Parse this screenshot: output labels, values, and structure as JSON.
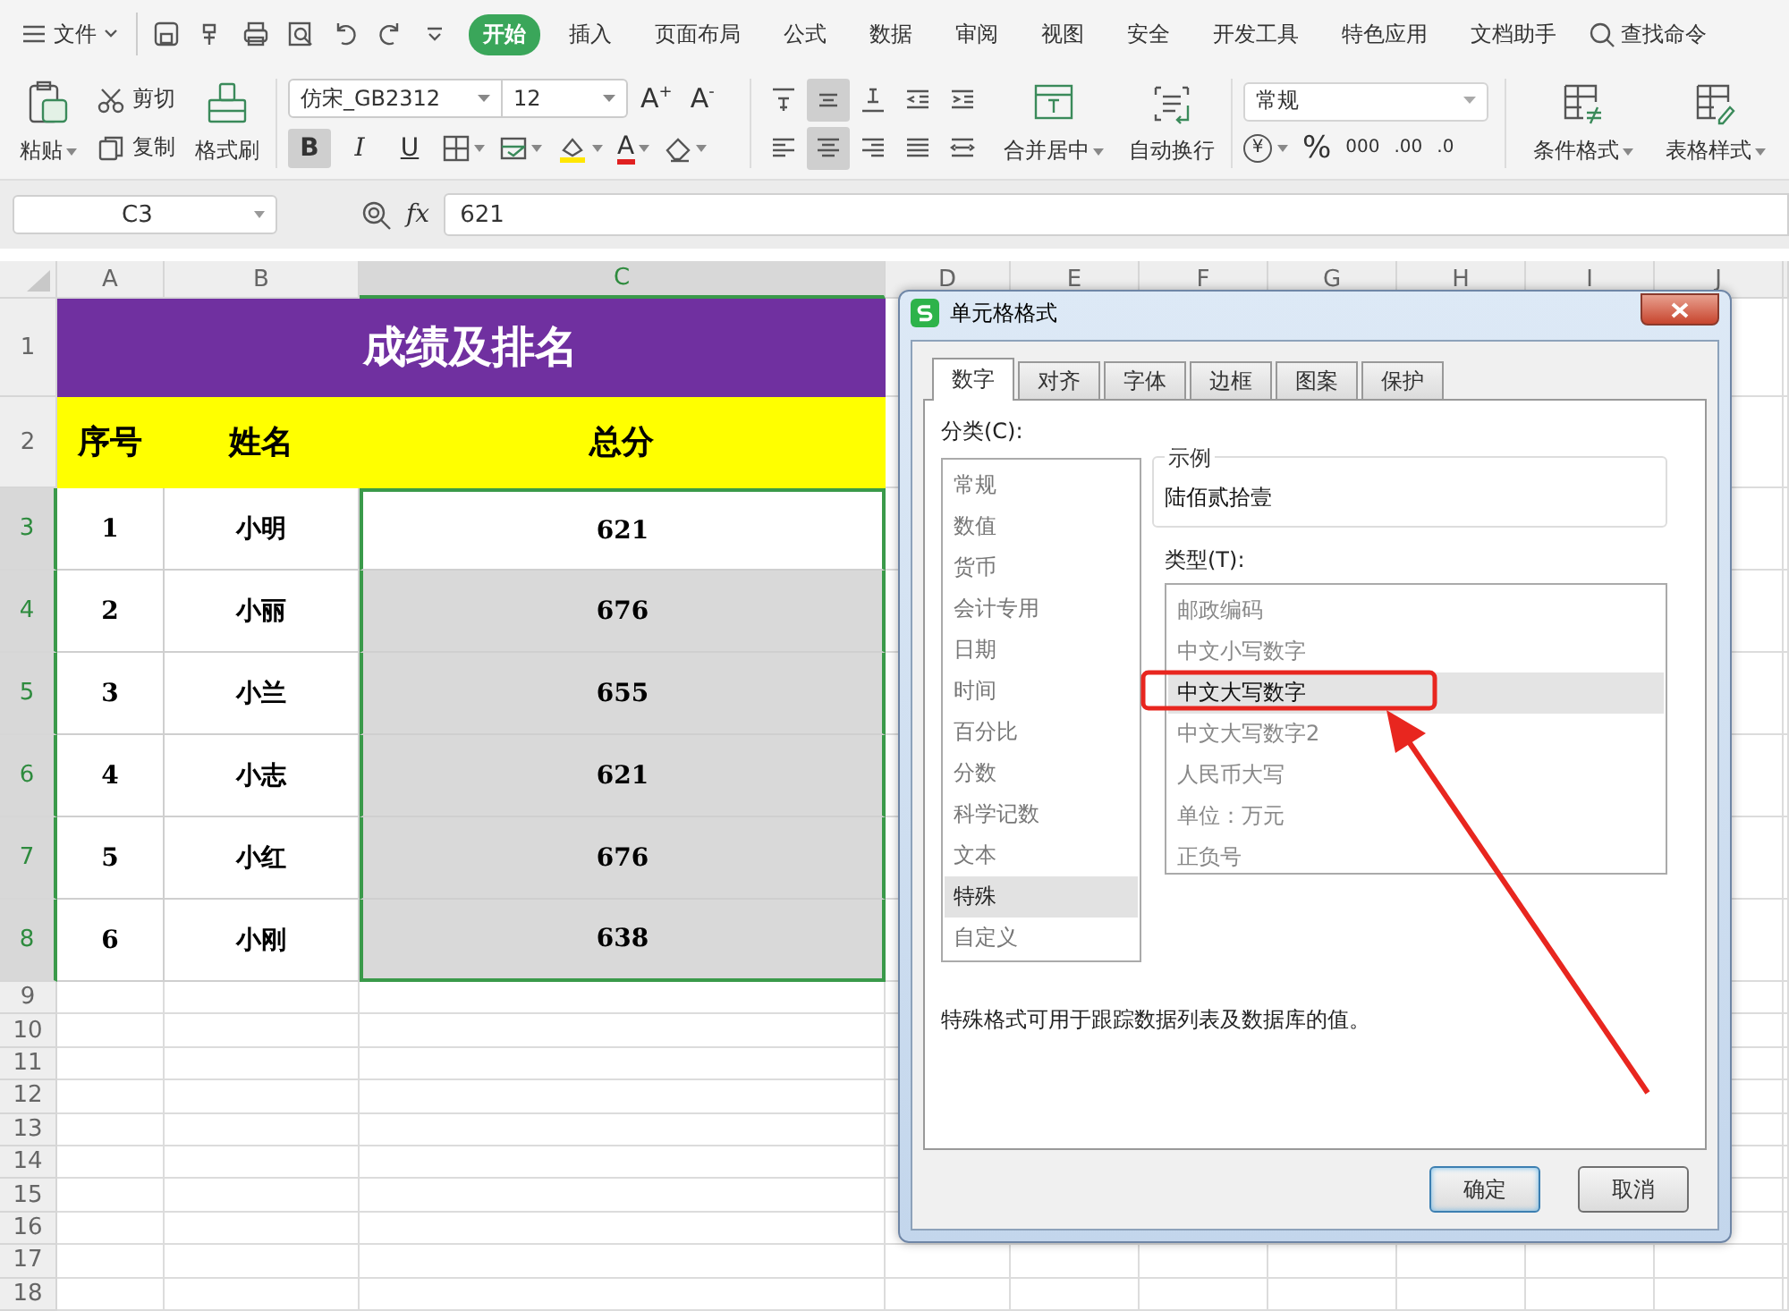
{
  "menu": {
    "file_label": "文件",
    "tabs": [
      {
        "label": "开始",
        "selected": true
      },
      {
        "label": "插入",
        "selected": false
      },
      {
        "label": "页面布局",
        "selected": false
      },
      {
        "label": "公式",
        "selected": false
      },
      {
        "label": "数据",
        "selected": false
      },
      {
        "label": "审阅",
        "selected": false
      },
      {
        "label": "视图",
        "selected": false
      },
      {
        "label": "安全",
        "selected": false
      },
      {
        "label": "开发工具",
        "selected": false
      },
      {
        "label": "特色应用",
        "selected": false
      },
      {
        "label": "文档助手",
        "selected": false
      }
    ],
    "search_label": "查找命令"
  },
  "ribbon": {
    "paste": "粘贴",
    "cut": "剪切",
    "copy": "复制",
    "format_painter": "格式刷",
    "font_name": "仿宋_GB2312",
    "font_size": "12",
    "size_buttons": [
      "A$^{+}$",
      "A$^{-}$"
    ],
    "font_styles": [
      {
        "kind": "bold",
        "label": "B",
        "on": true
      },
      {
        "kind": "italic",
        "label": "I",
        "on": false
      },
      {
        "kind": "underline",
        "label": "U",
        "on": false
      }
    ],
    "font_color_label": "A",
    "alignment": [
      {
        "kind": "top",
        "on": false
      },
      {
        "kind": "middle",
        "on": true
      },
      {
        "kind": "bottom",
        "on": false
      },
      {
        "kind": "left",
        "on": false
      },
      {
        "kind": "center",
        "on": true
      },
      {
        "kind": "right",
        "on": false
      }
    ],
    "merge_center": "合并居中",
    "wrap_text": "自动换行",
    "number_format": "常规",
    "number_buttons": [
      {
        "kind": "currency",
        "label": "¥"
      },
      {
        "kind": "percent",
        "label": "%"
      },
      {
        "kind": "thousands",
        "label": "000"
      },
      {
        "kind": "add_decimal",
        "label": ".00"
      },
      {
        "kind": "remove_decimal",
        "label": ".0"
      }
    ],
    "conditional_format": "条件格式",
    "table_style": "表格样式"
  },
  "formula_bar": {
    "cell_ref": "C3",
    "fx": "fx",
    "value": "621"
  },
  "sheet": {
    "columns": [
      {
        "label": "A",
        "selected": false
      },
      {
        "label": "B",
        "selected": false
      },
      {
        "label": "C",
        "selected": true
      },
      {
        "label": "D",
        "selected": false
      },
      {
        "label": "E",
        "selected": false
      },
      {
        "label": "F",
        "selected": false
      },
      {
        "label": "G",
        "selected": false
      },
      {
        "label": "H",
        "selected": false
      },
      {
        "label": "I",
        "selected": false
      },
      {
        "label": "J",
        "selected": false
      }
    ],
    "row_headers": [
      {
        "label": "1",
        "selected": false
      },
      {
        "label": "2",
        "selected": false
      },
      {
        "label": "3",
        "selected": true
      },
      {
        "label": "4",
        "selected": true
      },
      {
        "label": "5",
        "selected": true
      },
      {
        "label": "6",
        "selected": true
      },
      {
        "label": "7",
        "selected": true
      },
      {
        "label": "8",
        "selected": true
      },
      {
        "label": "9",
        "selected": false
      },
      {
        "label": "10",
        "selected": false
      },
      {
        "label": "11",
        "selected": false
      },
      {
        "label": "12",
        "selected": false
      },
      {
        "label": "13",
        "selected": false
      },
      {
        "label": "14",
        "selected": false
      },
      {
        "label": "15",
        "selected": false
      },
      {
        "label": "16",
        "selected": false
      },
      {
        "label": "17",
        "selected": false
      },
      {
        "label": "18",
        "selected": false
      }
    ],
    "title": "成绩及排名",
    "headers": [
      "序号",
      "姓名",
      "总分"
    ],
    "rows": [
      {
        "no": "1",
        "name": "小明",
        "total": "621",
        "selected": true,
        "active": true
      },
      {
        "no": "2",
        "name": "小丽",
        "total": "676",
        "selected": true,
        "active": false
      },
      {
        "no": "3",
        "name": "小兰",
        "total": "655",
        "selected": true,
        "active": false
      },
      {
        "no": "4",
        "name": "小志",
        "total": "621",
        "selected": true,
        "active": false
      },
      {
        "no": "5",
        "name": "小红",
        "total": "676",
        "selected": true,
        "active": false
      },
      {
        "no": "6",
        "name": "小刚",
        "total": "638",
        "selected": true,
        "active": false
      }
    ]
  },
  "dialog": {
    "title": "单元格格式",
    "tabs": [
      {
        "label": "数字",
        "selected": true
      },
      {
        "label": "对齐",
        "selected": false
      },
      {
        "label": "字体",
        "selected": false
      },
      {
        "label": "边框",
        "selected": false
      },
      {
        "label": "图案",
        "selected": false
      },
      {
        "label": "保护",
        "selected": false
      }
    ],
    "category_label": "分类(C):",
    "categories": [
      {
        "label": "常规",
        "selected": false
      },
      {
        "label": "数值",
        "selected": false
      },
      {
        "label": "货币",
        "selected": false
      },
      {
        "label": "会计专用",
        "selected": false
      },
      {
        "label": "日期",
        "selected": false
      },
      {
        "label": "时间",
        "selected": false
      },
      {
        "label": "百分比",
        "selected": false
      },
      {
        "label": "分数",
        "selected": false
      },
      {
        "label": "科学记数",
        "selected": false
      },
      {
        "label": "文本",
        "selected": false
      },
      {
        "label": "特殊",
        "selected": true
      },
      {
        "label": "自定义",
        "selected": false
      }
    ],
    "sample_label": "示例",
    "sample_value": "陆佰贰拾壹",
    "type_label": "类型(T):",
    "types": [
      {
        "label": "邮政编码",
        "selected": false
      },
      {
        "label": "中文小写数字",
        "selected": false
      },
      {
        "label": "中文大写数字",
        "selected": true
      },
      {
        "label": "中文大写数字2",
        "selected": false
      },
      {
        "label": "人民币大写",
        "selected": false
      },
      {
        "label": "单位：万元",
        "selected": false
      },
      {
        "label": "正负号",
        "selected": false
      }
    ],
    "description": "特殊格式可用于跟踪数据列表及数据库的值。",
    "buttons": [
      {
        "label": "确定",
        "default": true
      },
      {
        "label": "取消",
        "default": false
      }
    ]
  }
}
